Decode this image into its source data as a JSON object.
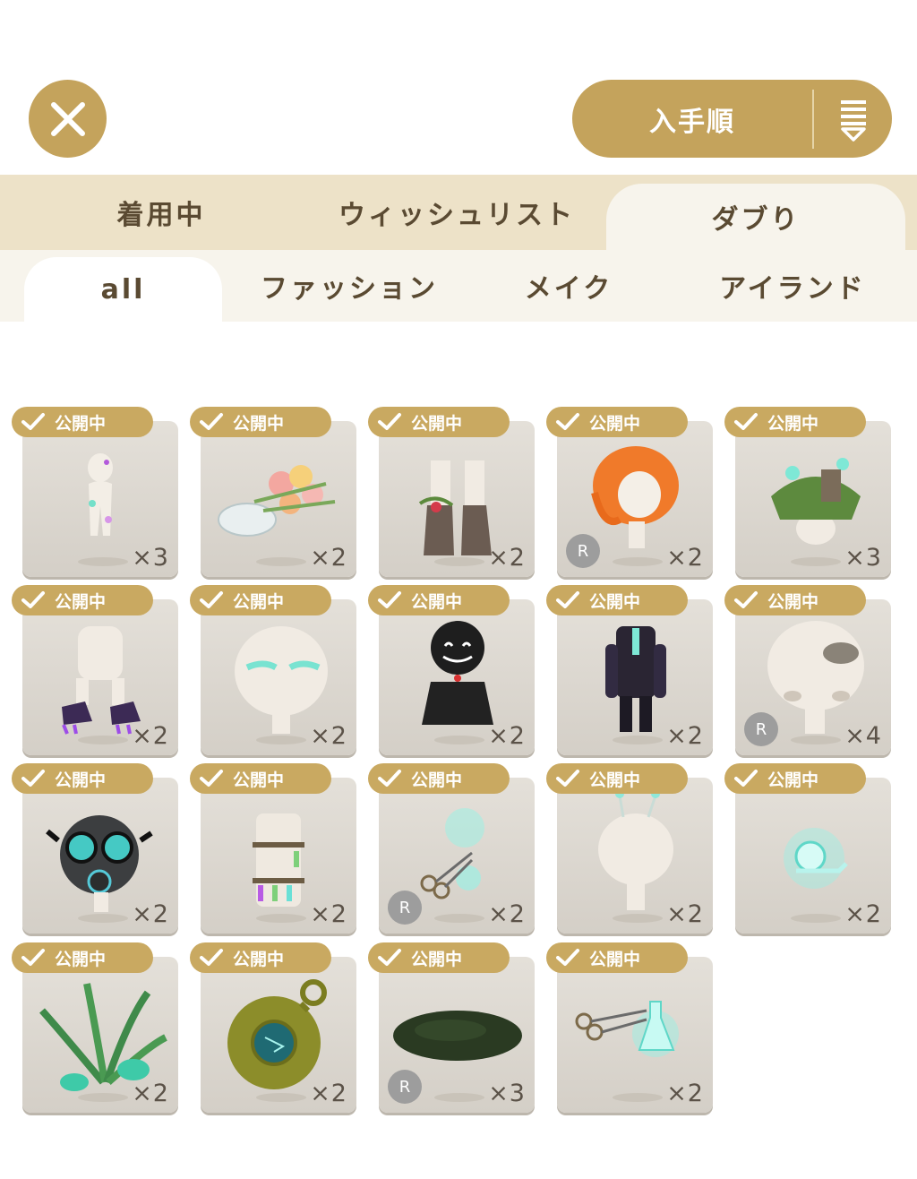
{
  "header": {
    "sort_label": "入手順",
    "accent_color": "#c4a35c"
  },
  "main_tabs": [
    {
      "label": "着用中",
      "active": false
    },
    {
      "label": "ウィッシュリスト",
      "active": false
    },
    {
      "label": "ダブり",
      "active": true
    }
  ],
  "sub_tabs": [
    {
      "label": "all",
      "active": true
    },
    {
      "label": "ファッション",
      "active": false
    },
    {
      "label": "メイク",
      "active": false
    },
    {
      "label": "アイランド",
      "active": false
    }
  ],
  "items": [
    {
      "badge": "公開中",
      "count": "×3",
      "rarity": "",
      "icon": "pastel-bodysuit-icon"
    },
    {
      "badge": "公開中",
      "count": "×2",
      "rarity": "",
      "icon": "flower-bouquet-icon"
    },
    {
      "badge": "公開中",
      "count": "×2",
      "rarity": "",
      "icon": "flower-boots-icon"
    },
    {
      "badge": "公開中",
      "count": "×2",
      "rarity": "R",
      "icon": "orange-hair-icon"
    },
    {
      "badge": "公開中",
      "count": "×3",
      "rarity": "",
      "icon": "moss-hat-icon"
    },
    {
      "badge": "公開中",
      "count": "×2",
      "rarity": "",
      "icon": "purple-claw-shoes-icon"
    },
    {
      "badge": "公開中",
      "count": "×2",
      "rarity": "",
      "icon": "teal-eyeshadow-icon"
    },
    {
      "badge": "公開中",
      "count": "×2",
      "rarity": "",
      "icon": "black-monster-costume-icon"
    },
    {
      "badge": "公開中",
      "count": "×2",
      "rarity": "",
      "icon": "dark-suit-outfit-icon"
    },
    {
      "badge": "公開中",
      "count": "×4",
      "rarity": "R",
      "icon": "dirt-face-paint-icon"
    },
    {
      "badge": "公開中",
      "count": "×2",
      "rarity": "",
      "icon": "gas-mask-icon"
    },
    {
      "badge": "公開中",
      "count": "×2",
      "rarity": "",
      "icon": "potion-vial-dress-icon"
    },
    {
      "badge": "公開中",
      "count": "×2",
      "rarity": "R",
      "icon": "glowing-scissors-icon"
    },
    {
      "badge": "公開中",
      "count": "×2",
      "rarity": "",
      "icon": "antenna-headband-icon"
    },
    {
      "badge": "公開中",
      "count": "×2",
      "rarity": "",
      "icon": "glowing-snail-icon"
    },
    {
      "badge": "公開中",
      "count": "×2",
      "rarity": "",
      "icon": "fern-plant-icon"
    },
    {
      "badge": "公開中",
      "count": "×2",
      "rarity": "",
      "icon": "gear-mine-icon"
    },
    {
      "badge": "公開中",
      "count": "×3",
      "rarity": "R",
      "icon": "moss-rug-icon"
    },
    {
      "badge": "公開中",
      "count": "×2",
      "rarity": "",
      "icon": "flask-scissors-icon"
    }
  ]
}
